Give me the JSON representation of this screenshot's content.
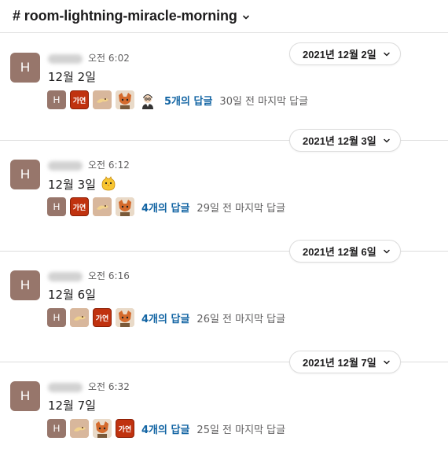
{
  "channel": {
    "title": "# room-lightning-miracle-morning"
  },
  "days": [
    {
      "date": "2021년 12월 2일",
      "message": {
        "avatar": "H",
        "time": "오전 6:02",
        "text": "12월 2일",
        "emoji": null,
        "replies": {
          "avatars": [
            "H",
            "가연",
            "cat",
            "fox",
            "person"
          ],
          "count": "5개의 답글",
          "last": "30일 전 마지막 답글"
        }
      }
    },
    {
      "date": "2021년 12월 3일",
      "message": {
        "avatar": "H",
        "time": "오전 6:12",
        "text": "12월 3일",
        "emoji": "chick-icon",
        "replies": {
          "avatars": [
            "H",
            "가연",
            "cat",
            "fox"
          ],
          "count": "4개의 답글",
          "last": "29일 전 마지막 답글"
        }
      }
    },
    {
      "date": "2021년 12월 6일",
      "message": {
        "avatar": "H",
        "time": "오전 6:16",
        "text": "12월 6일",
        "emoji": null,
        "replies": {
          "avatars": [
            "H",
            "cat",
            "가연",
            "fox"
          ],
          "count": "4개의 답글",
          "last": "26일 전 마지막 답글"
        }
      }
    },
    {
      "date": "2021년 12월 7일",
      "message": {
        "avatar": "H",
        "time": "오전 6:32",
        "text": "12월 7일",
        "emoji": null,
        "replies": {
          "avatars": [
            "H",
            "cat",
            "fox",
            "가연"
          ],
          "count": "4개의 답글",
          "last": "25일 전 마지막 답글"
        }
      }
    }
  ],
  "colors": {
    "link": "#1264a3",
    "avatar": "#97766b",
    "badge": "#c0320f"
  }
}
